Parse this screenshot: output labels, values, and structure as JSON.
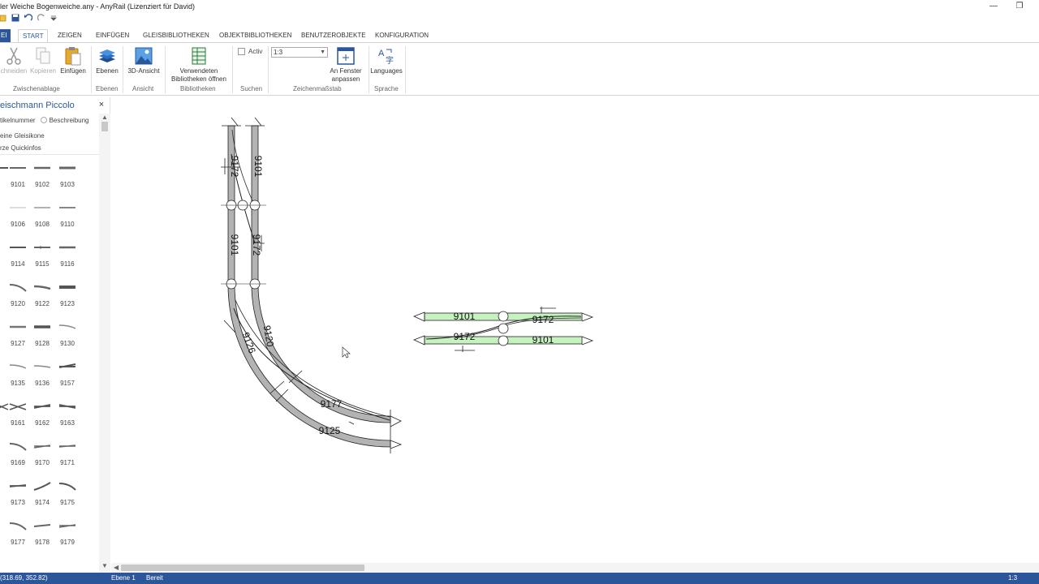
{
  "window": {
    "title": "ler Weiche Bogenweiche.any - AnyRail (Lizenziert für David)",
    "minimize_glyph": "—",
    "restore_glyph": "❐"
  },
  "quick_access": {
    "icons": [
      "open-icon",
      "save-icon",
      "undo-icon",
      "redo-icon",
      "customize-icon"
    ]
  },
  "ribbon": {
    "file_tab": "EI",
    "tabs": [
      "START",
      "ZEIGEN",
      "EINFÜGEN",
      "GLEISBIBLIOTHEKEN",
      "OBJEKTBIBLIOTHEKEN",
      "BENUTZEROBJEKTE",
      "KONFIGURATION"
    ],
    "active_tab": "START",
    "buttons": {
      "ausschneiden": "chneiden",
      "kopieren": "Kopieren",
      "einfuegen": "Einfügen",
      "ebenen": "Ebenen",
      "ansicht3d": "3D-Ansicht",
      "bibliotheken_line1": "Verwendeten",
      "bibliotheken_line2": "Bibliotheken öffnen",
      "activ": "Activ",
      "scale_value": "1:3",
      "fenster_line1": "An Fenster",
      "fenster_line2": "anpassen",
      "languages": "Languages"
    },
    "groups": {
      "zwischenablage": "Zwischenablage",
      "ebenen": "Ebenen",
      "ansicht": "Ansicht",
      "bibliotheken": "Bibliotheken",
      "suchen": "Suchen",
      "zeichenmassstab": "Zeichenmaßstab",
      "sprache": "Sprache"
    }
  },
  "panel": {
    "title": "eischmann Piccolo",
    "close_glyph": "×",
    "radio_artikelnummer": "tikelnummer",
    "radio_beschreibung": "Beschreibung",
    "option1": "eine Gleisikone",
    "option2": "rze Quickinfos",
    "rows": [
      [
        "",
        "9101",
        "9102",
        "9103"
      ],
      [
        "",
        "9106",
        "9108",
        "9110"
      ],
      [
        "",
        "9114",
        "9115",
        "9116"
      ],
      [
        "",
        "9120",
        "9122",
        "9123"
      ],
      [
        "",
        "9127",
        "9128",
        "9130"
      ],
      [
        "",
        "9135",
        "9136",
        "9157"
      ],
      [
        "",
        "9161",
        "9162",
        "9163"
      ],
      [
        "",
        "9169",
        "9170",
        "9171"
      ],
      [
        "",
        "9173",
        "9174",
        "9175"
      ],
      [
        "",
        "9177",
        "9178",
        "9179"
      ]
    ]
  },
  "canvas_labels": {
    "left_upper_1": "9172",
    "left_upper_2": "9101",
    "left_mid_1": "9101",
    "left_mid_2": "9172",
    "curve_inner": "9126",
    "curve_outer": "9120",
    "curve_9177": "9177",
    "curve_9125": "9125",
    "right_top_left": "9101",
    "right_top_right": "9172",
    "right_bottom_left": "9172",
    "right_bottom_right": "9101"
  },
  "status": {
    "coords": "(318.69, 352.82)",
    "layer": "Ebene 1",
    "state": "Bereit",
    "zoom": "1:3"
  },
  "colors": {
    "accent": "#2b579a",
    "track_fill": "#b3b3b3",
    "selected_track_fill": "#c6f2c0"
  }
}
